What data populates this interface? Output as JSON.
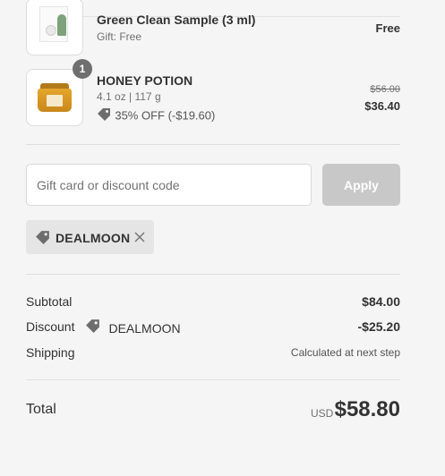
{
  "items": [
    {
      "name": "Green Clean Sample (3 ml)",
      "subtitle": "Gift: Free",
      "price": "Free",
      "image_icon": "sample-product-icon"
    },
    {
      "name": "HONEY POTION",
      "quantity": "1",
      "subtitle": "4.1 oz | 117 g",
      "discount_text": "35% OFF (-$19.60)",
      "original_price": "$56.00",
      "price": "$36.40",
      "image_icon": "honey-jar-icon"
    }
  ],
  "discount_form": {
    "placeholder": "Gift card or discount code",
    "value": "",
    "apply_label": "Apply"
  },
  "applied_code": {
    "code": "DEALMOON",
    "tag_icon": "tag-icon",
    "remove_icon": "close-icon"
  },
  "summary": {
    "subtotal_label": "Subtotal",
    "subtotal_value": "$84.00",
    "discount_label": "Discount",
    "discount_code": "DEALMOON",
    "discount_value": "-$25.20",
    "shipping_label": "Shipping",
    "shipping_value": "Calculated at next step",
    "total_label": "Total",
    "currency": "USD",
    "total_value": "$58.80"
  },
  "colors": {
    "background": "#f5f5f5",
    "apply_button_disabled": "#c8c8c8",
    "chip_background": "#e5e5e5",
    "qty_badge": "#6f6f6f",
    "text": "#333333"
  }
}
